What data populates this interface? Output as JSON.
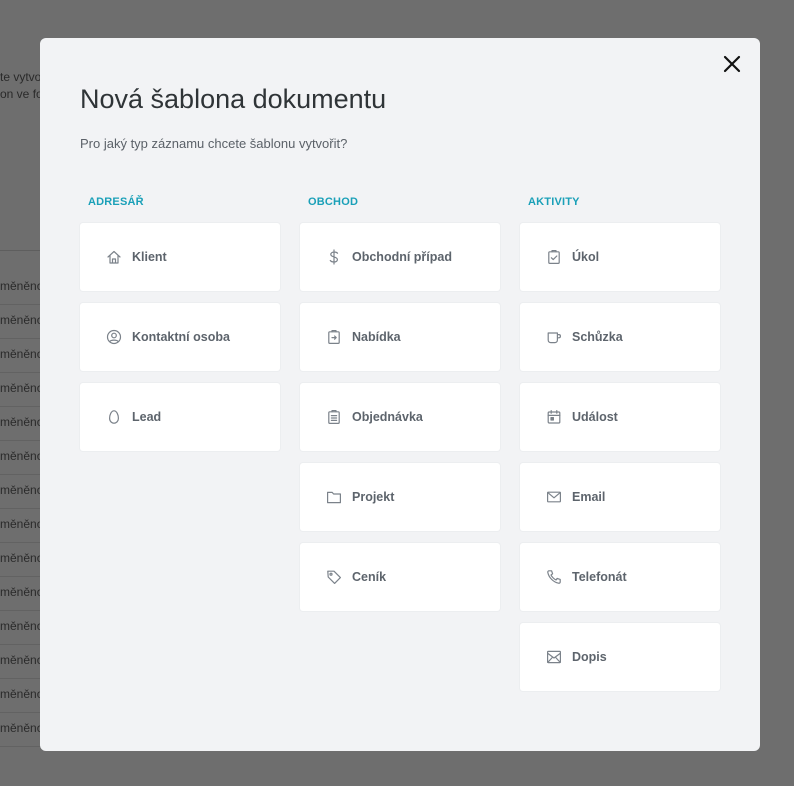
{
  "background": {
    "top_lines": [
      "te vytvo",
      "on ve fo"
    ],
    "rows": [
      "měněno",
      "měněno",
      "měněno",
      "měněno",
      "měněno",
      "měněno",
      "měněno",
      "měněno",
      "měněno",
      "měněno",
      "měněno",
      "měněno",
      "měněno",
      "měněno"
    ]
  },
  "modal": {
    "title": "Nová šablona dokumentu",
    "subtitle": "Pro jaký typ záznamu chcete šablonu vytvořit?",
    "columns": [
      {
        "header": "ADRESÁŘ",
        "items": [
          {
            "label": "Klient",
            "icon": "home-icon"
          },
          {
            "label": "Kontaktní osoba",
            "icon": "user-circle-icon"
          },
          {
            "label": "Lead",
            "icon": "egg-icon"
          }
        ]
      },
      {
        "header": "OBCHOD",
        "items": [
          {
            "label": "Obchodní případ",
            "icon": "dollar-icon"
          },
          {
            "label": "Nabídka",
            "icon": "clipboard-arrow-icon"
          },
          {
            "label": "Objednávka",
            "icon": "clipboard-list-icon"
          },
          {
            "label": "Projekt",
            "icon": "folder-icon"
          },
          {
            "label": "Ceník",
            "icon": "tag-icon"
          }
        ]
      },
      {
        "header": "AKTIVITY",
        "items": [
          {
            "label": "Úkol",
            "icon": "clipboard-check-icon"
          },
          {
            "label": "Schůzka",
            "icon": "cup-icon"
          },
          {
            "label": "Událost",
            "icon": "calendar-icon"
          },
          {
            "label": "Email",
            "icon": "mail-icon"
          },
          {
            "label": "Telefonát",
            "icon": "phone-icon"
          },
          {
            "label": "Dopis",
            "icon": "letter-icon"
          }
        ]
      }
    ]
  },
  "colors": {
    "accent": "#1aa0b8",
    "label": "#5d646c",
    "icon": "#7b828a"
  }
}
